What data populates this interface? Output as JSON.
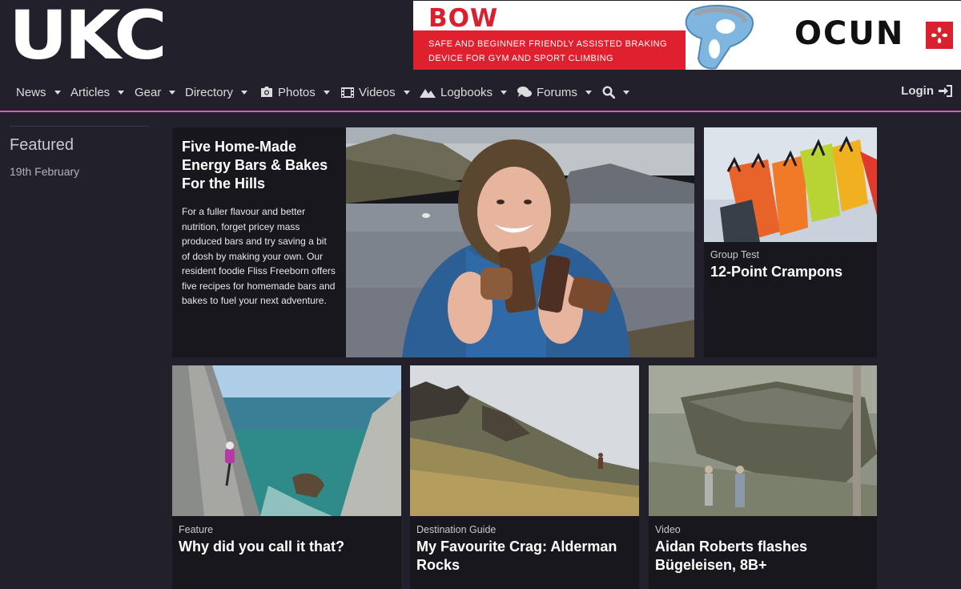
{
  "site": {
    "logo": "UKC"
  },
  "ad": {
    "headline": "BOW",
    "line1": "SAFE AND BEGINNER FRIENDLY ASSISTED BRAKING",
    "line2": "DEVICE FOR GYM AND SPORT CLIMBING",
    "brand": "OCUN",
    "colors": {
      "red": "#e0202e",
      "device": "#7fb6e0"
    }
  },
  "nav": {
    "items": [
      {
        "label": "News",
        "icon": null
      },
      {
        "label": "Articles",
        "icon": null
      },
      {
        "label": "Gear",
        "icon": null
      },
      {
        "label": "Directory",
        "icon": null
      },
      {
        "label": "Photos",
        "icon": "camera-icon"
      },
      {
        "label": "Videos",
        "icon": "film-icon"
      },
      {
        "label": "Logbooks",
        "icon": "mountain-icon"
      },
      {
        "label": "Forums",
        "icon": "chat-icon"
      },
      {
        "label": "",
        "icon": "search-icon"
      }
    ],
    "login": "Login",
    "accent": "#e05aa5"
  },
  "sidebar": {
    "title": "Featured",
    "date": "19th February"
  },
  "hero": {
    "title": "Five Home-Made Energy Bars & Bakes For the Hills",
    "description": "For a fuller flavour and better nutrition, forget pricey mass produced bars and try saving a bit of dosh by making your own. Our resident foodie Fliss Freeborn offers five recipes for homemade bars and bakes to fuel your next adventure."
  },
  "cards": {
    "crampons": {
      "category": "Group Test",
      "title": "12-Point Crampons"
    },
    "feature": {
      "category": "Feature",
      "title": "Why did you call it that?"
    },
    "destination": {
      "category": "Destination Guide",
      "title": "My Favourite Crag: Alderman Rocks"
    },
    "video": {
      "category": "Video",
      "title": "Aidan Roberts flashes Bügeleisen, 8B+"
    }
  }
}
